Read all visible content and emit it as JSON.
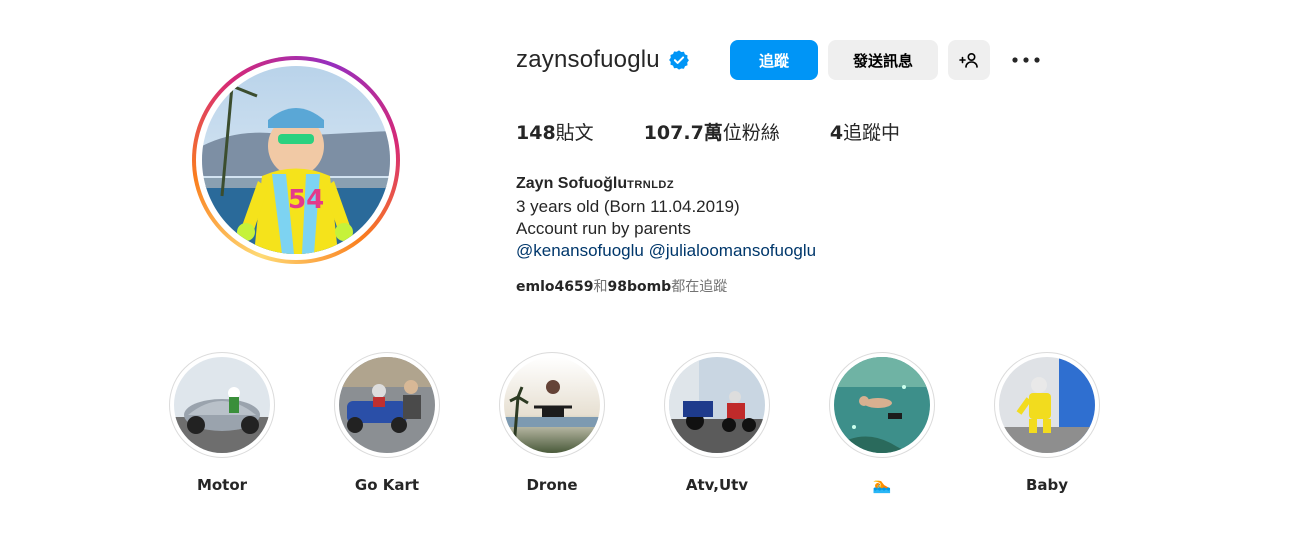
{
  "profile": {
    "username": "zaynsofuoglu",
    "verified_icon": "verified-badge-icon",
    "accent_color": "#0095f6"
  },
  "actions": {
    "follow_label": "追蹤",
    "message_label": "發送訊息",
    "suggest_icon": "add-person-icon",
    "more_icon": "more-options-icon"
  },
  "stats": {
    "posts_count": "148",
    "posts_label": "貼文",
    "followers_count": "107.7萬",
    "followers_label": "位粉絲",
    "following_count": "4",
    "following_label": "追蹤中"
  },
  "bio": {
    "name": "Zayn Sofuoğlu",
    "pronoun": "TRNLDZ",
    "line1": "3 years old (Born 11.04.2019)",
    "line2": "Account run by parents",
    "mention1": "@kenansofuoglu",
    "mention2": "@julialoomansofuoglu"
  },
  "followed_by": {
    "user1": "emlo4659",
    "and_text": "和",
    "user2": "98bomb",
    "suffix": "都在追蹤"
  },
  "highlights": [
    {
      "label": "Motor"
    },
    {
      "label": "Go Kart"
    },
    {
      "label": "Drone"
    },
    {
      "label": "Atv,Utv"
    },
    {
      "label": "🏊"
    },
    {
      "label": "Baby"
    }
  ]
}
